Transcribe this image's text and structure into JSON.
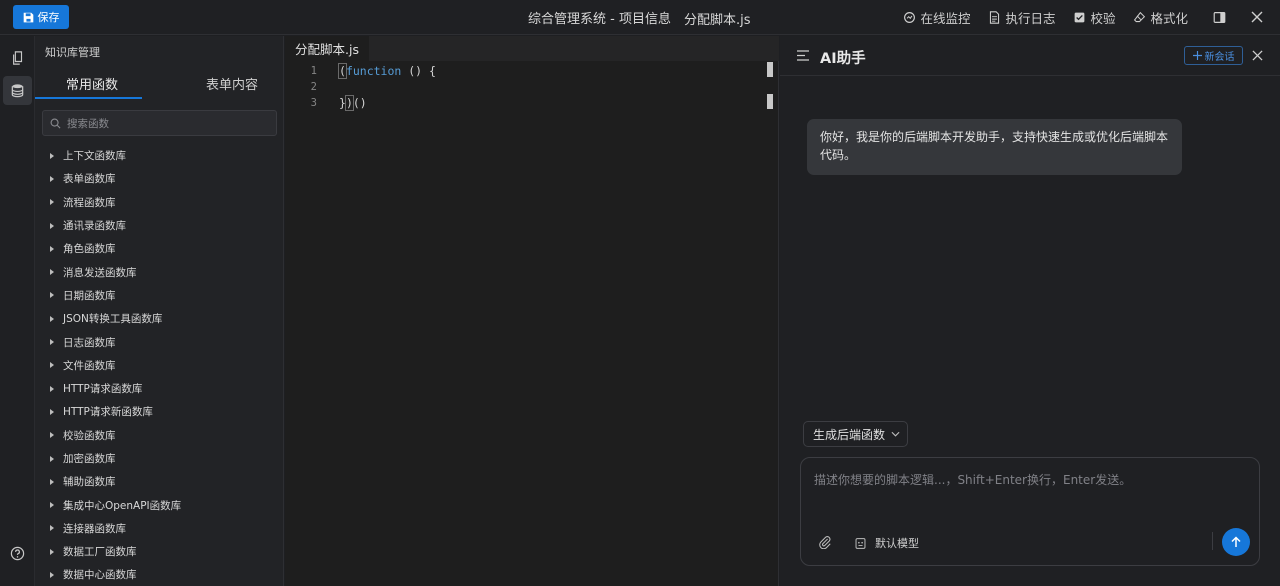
{
  "topbar": {
    "save_label": "保存",
    "title": "综合管理系统 - 项目信息",
    "file": "分配脚本.js",
    "actions": [
      {
        "label": "在线监控",
        "icon": "monitor-icon"
      },
      {
        "label": "执行日志",
        "icon": "log-file-icon"
      },
      {
        "label": "校验",
        "icon": "checkbox-icon"
      },
      {
        "label": "格式化",
        "icon": "eraser-icon"
      }
    ]
  },
  "rail": {
    "items": [
      {
        "icon": "files-icon",
        "active": false
      },
      {
        "icon": "database-icon",
        "active": true
      },
      {
        "icon": "help-icon",
        "active": false
      }
    ]
  },
  "knowledge": {
    "title": "知识库管理",
    "tabs": [
      "常用函数",
      "表单内容"
    ],
    "search_placeholder": "搜索函数",
    "items": [
      "上下文函数库",
      "表单函数库",
      "流程函数库",
      "通讯录函数库",
      "角色函数库",
      "消息发送函数库",
      "日期函数库",
      "JSON转换工具函数库",
      "日志函数库",
      "文件函数库",
      "HTTP请求函数库",
      "HTTP请求新函数库",
      "校验函数库",
      "加密函数库",
      "辅助函数库",
      "集成中心OpenAPI函数库",
      "连接器函数库",
      "数据工厂函数库",
      "数据中心函数库"
    ]
  },
  "editor": {
    "tab": "分配脚本.js",
    "line_numbers": [
      "1",
      "2",
      "3"
    ],
    "lines": {
      "l1_open": "(",
      "l1_kw": "function",
      "l1_rest": " () {",
      "l2": "",
      "l3_a": "}",
      "l3_b": ")",
      "l3_c": "()"
    }
  },
  "ai": {
    "title": "AI助手",
    "new_chat": "新会话",
    "greeting": "你好，我是你的后端脚本开发助手，支持快速生成或优化后端脚本代码。",
    "chip": "生成后端函数",
    "input_placeholder": "描述你想要的脚本逻辑...，Shift+Enter换行，Enter发送。",
    "model": "默认模型"
  },
  "colors": {
    "accent": "#1677d9",
    "keyword": "#569cd6"
  }
}
